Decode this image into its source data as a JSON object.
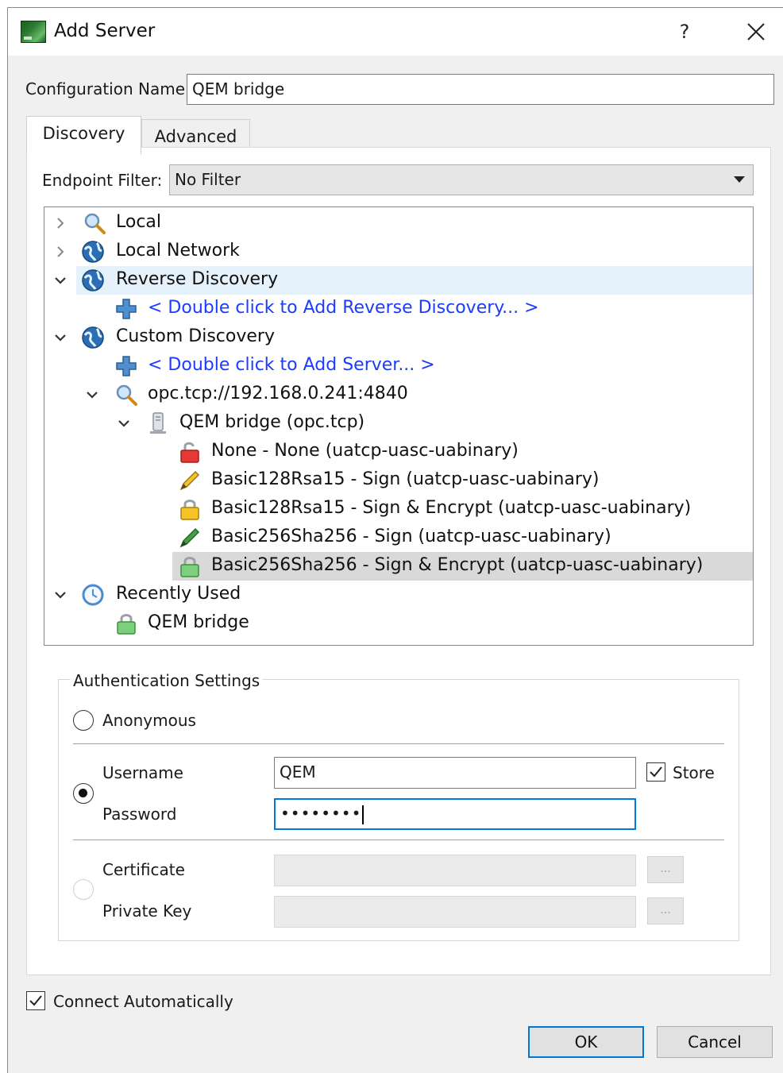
{
  "window": {
    "title": "Add Server",
    "help_label": "?",
    "icon": "app-icon",
    "close_icon": "close-icon"
  },
  "config": {
    "name_label": "Configuration Name",
    "name_value": "QEM bridge"
  },
  "tabs": [
    {
      "label": "Discovery",
      "active": true
    },
    {
      "label": "Advanced",
      "active": false
    }
  ],
  "filter": {
    "label": "Endpoint Filter:",
    "selected": "No Filter"
  },
  "tree": {
    "items": [
      {
        "label": "Local",
        "icon": "search-icon",
        "expanded": false
      },
      {
        "label": "Local Network",
        "icon": "globe-icon",
        "expanded": false
      },
      {
        "label": "Reverse Discovery",
        "icon": "globe-icon",
        "expanded": true
      },
      {
        "label": "< Double click to Add Reverse Discovery... >",
        "icon": "plus-icon"
      },
      {
        "label": "Custom Discovery",
        "icon": "globe-icon",
        "expanded": true
      },
      {
        "label": "< Double click to Add Server... >",
        "icon": "plus-icon"
      },
      {
        "label": "opc.tcp://192.168.0.241:4840",
        "icon": "search-icon",
        "expanded": true
      },
      {
        "label": "QEM bridge (opc.tcp)",
        "icon": "server-icon",
        "expanded": true
      },
      {
        "label": "None - None (uatcp-uasc-uabinary)",
        "icon": "lock-open-red-icon"
      },
      {
        "label": "Basic128Rsa15 - Sign (uatcp-uasc-uabinary)",
        "icon": "pencil-yellow-icon"
      },
      {
        "label": "Basic128Rsa15 - Sign & Encrypt (uatcp-uasc-uabinary)",
        "icon": "lock-yellow-icon"
      },
      {
        "label": "Basic256Sha256 - Sign (uatcp-uasc-uabinary)",
        "icon": "pencil-green-icon"
      },
      {
        "label": "Basic256Sha256 - Sign & Encrypt (uatcp-uasc-uabinary)",
        "icon": "lock-green-icon"
      },
      {
        "label": "Recently Used",
        "icon": "clock-icon",
        "expanded": true
      },
      {
        "label": "QEM bridge",
        "icon": "lock-green-icon"
      }
    ]
  },
  "auth": {
    "title": "Authentication Settings",
    "anonymous_label": "Anonymous",
    "username_label": "Username",
    "username_value": "QEM",
    "password_label": "Password",
    "password_value": "••••••••",
    "store_label": "Store",
    "certificate_label": "Certificate",
    "private_key_label": "Private Key",
    "browse_label": "..."
  },
  "footer": {
    "connect_auto_label": "Connect Automatically",
    "ok_label": "OK",
    "cancel_label": "Cancel"
  },
  "colors": {
    "link": "#1a3cff",
    "highlight": "#e5f1fb",
    "selected": "#d9d9d9",
    "focus": "#0078d7"
  }
}
